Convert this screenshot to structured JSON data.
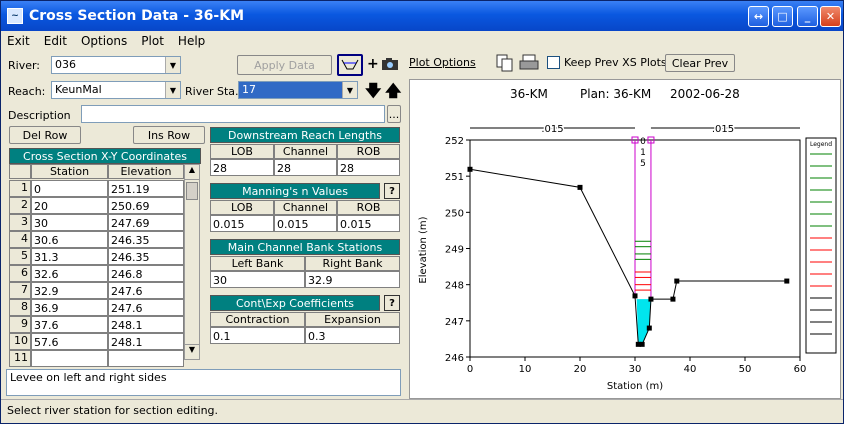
{
  "window": {
    "title": "Cross Section Data - 36-KM"
  },
  "menu": [
    "Exit",
    "Edit",
    "Options",
    "Plot",
    "Help"
  ],
  "river": {
    "label": "River:",
    "value": "036"
  },
  "reach": {
    "label": "Reach:",
    "value": "KeunMal"
  },
  "river_sta": {
    "label": "River Sta.:",
    "value": "17"
  },
  "apply_label": "Apply Data",
  "description": {
    "label": "Description",
    "value": "",
    "button": "..."
  },
  "del_row": "Del Row",
  "ins_row": "Ins Row",
  "xs_table": {
    "title": "Cross Section X-Y Coordinates",
    "columns": [
      "Station",
      "Elevation"
    ],
    "rows": [
      [
        "1",
        "0",
        "251.19"
      ],
      [
        "2",
        "20",
        "250.69"
      ],
      [
        "3",
        "30",
        "247.69"
      ],
      [
        "4",
        "30.6",
        "246.35"
      ],
      [
        "5",
        "31.3",
        "246.35"
      ],
      [
        "6",
        "32.6",
        "246.8"
      ],
      [
        "7",
        "32.9",
        "247.6"
      ],
      [
        "8",
        "36.9",
        "247.6"
      ],
      [
        "9",
        "37.6",
        "248.1"
      ],
      [
        "10",
        "57.6",
        "248.1"
      ],
      [
        "11",
        "",
        ""
      ]
    ]
  },
  "downstream": {
    "title": "Downstream Reach Lengths",
    "columns": [
      "LOB",
      "Channel",
      "ROB"
    ],
    "values": [
      "28",
      "28",
      "28"
    ]
  },
  "mannings": {
    "title": "Manning's n Values",
    "columns": [
      "LOB",
      "Channel",
      "ROB"
    ],
    "values": [
      "0.015",
      "0.015",
      "0.015"
    ]
  },
  "bank": {
    "title": "Main Channel Bank Stations",
    "columns": [
      "Left Bank",
      "Right Bank"
    ],
    "values": [
      "30",
      "32.9"
    ]
  },
  "coef": {
    "title": "Cont\\Exp  Coefficients",
    "columns": [
      "Contraction",
      "Expansion"
    ],
    "values": [
      "0.1",
      "0.3"
    ]
  },
  "help": "?",
  "note": "Levee on left and right sides",
  "status": "Select river station for section editing.",
  "plot_options": "Plot Options",
  "keep_prev": "Keep Prev XS Plots",
  "clear_prev": "Clear Prev",
  "plot_header": {
    "name": "36-KM",
    "plan": "Plan: 36-KM",
    "date": "2002-06-28"
  },
  "legend_title": "Legend",
  "chart_data": {
    "type": "line",
    "xlabel": "Station (m)",
    "ylabel": "Elevation (m)",
    "xlim": [
      0,
      60
    ],
    "ylim": [
      246,
      252
    ],
    "xticks": [
      "0",
      "10",
      "20",
      "30",
      "40",
      "50",
      "60"
    ],
    "yticks": [
      "246",
      "247",
      "248",
      "249",
      "250",
      "251",
      "252"
    ],
    "ground": {
      "x": [
        0,
        20,
        30,
        30.6,
        31.3,
        32.6,
        32.9,
        36.9,
        37.6,
        57.6
      ],
      "y": [
        251.19,
        250.69,
        247.69,
        246.35,
        246.35,
        246.8,
        247.6,
        247.6,
        248.1,
        248.1
      ]
    },
    "n_labels": [
      ".015",
      ".015"
    ],
    "channel_n": [
      "0",
      "1",
      "5"
    ],
    "colors": {
      "ground": "#000000",
      "water": "#00e5ee",
      "ws_green": "#008000",
      "ws_red": "#ff0000",
      "bank": "#cc00cc"
    }
  }
}
